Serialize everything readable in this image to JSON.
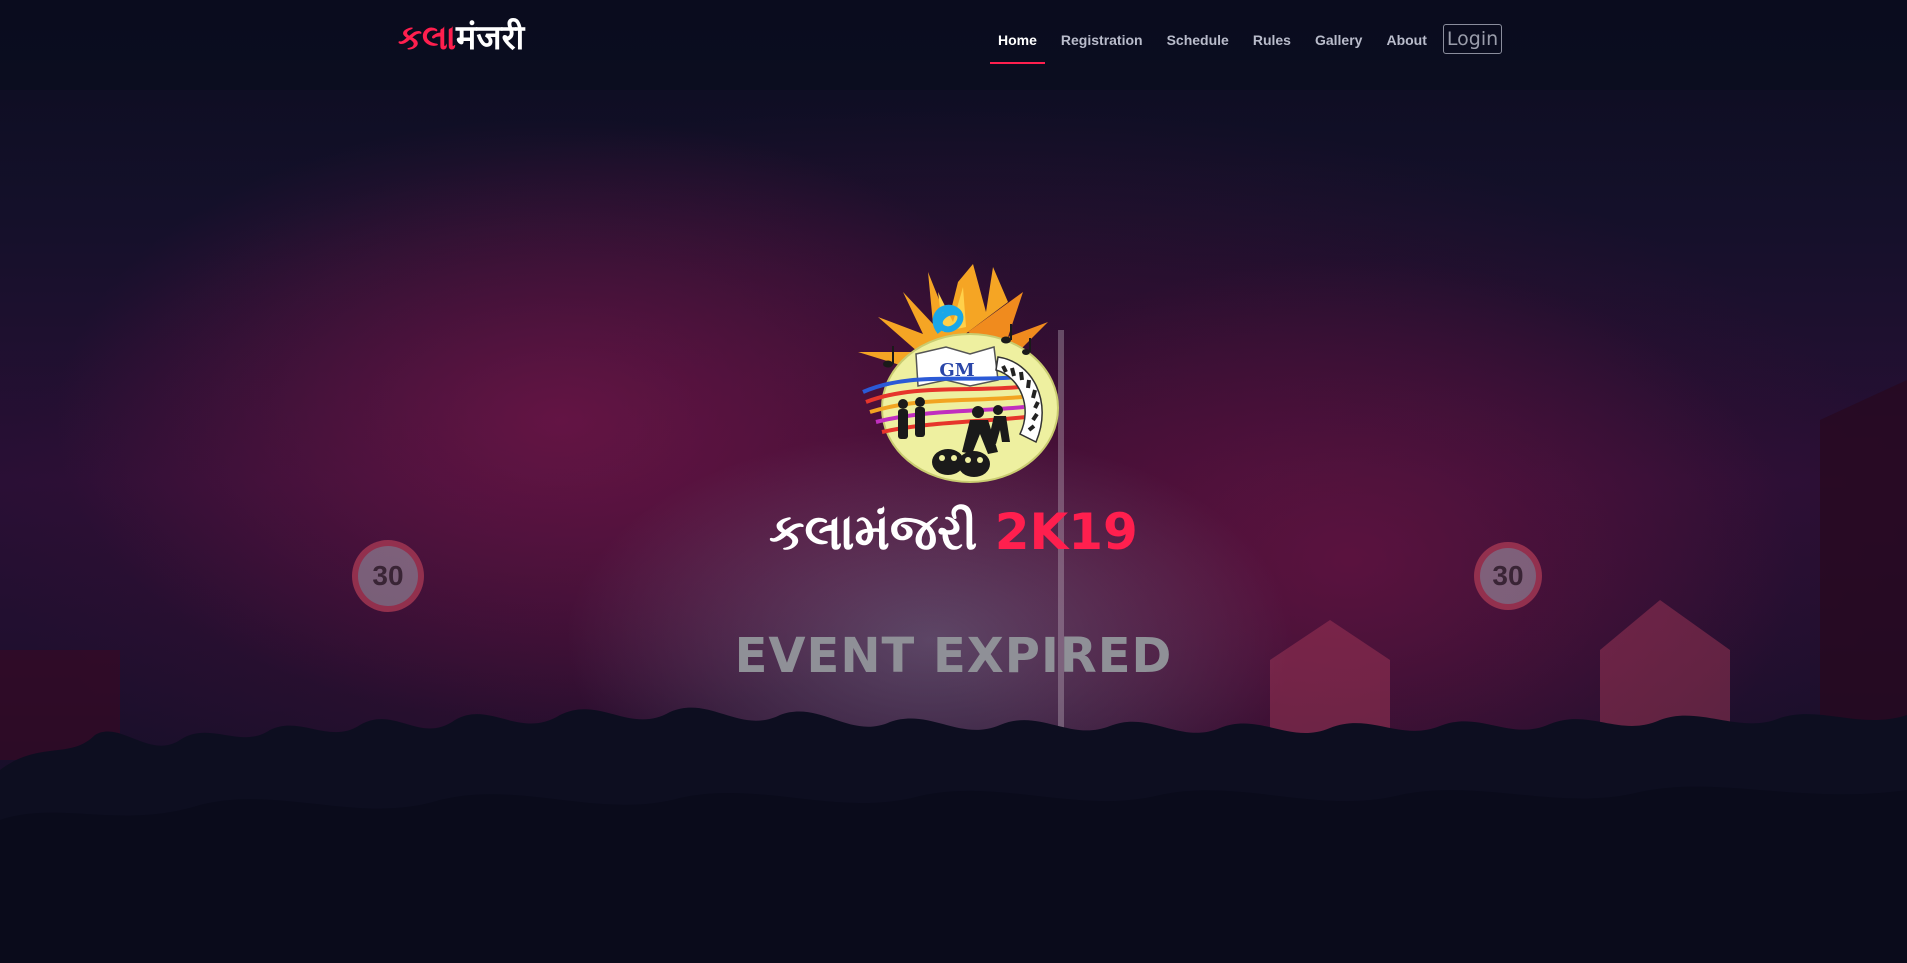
{
  "brand": {
    "part_red": "કલા",
    "part_white": "मंजरी"
  },
  "nav": {
    "items": [
      {
        "label": "Home",
        "active": true
      },
      {
        "label": "Registration",
        "active": false
      },
      {
        "label": "Schedule",
        "active": false
      },
      {
        "label": "Rules",
        "active": false
      },
      {
        "label": "Gallery",
        "active": false
      },
      {
        "label": "About",
        "active": false
      }
    ],
    "login_label": "Login"
  },
  "hero": {
    "logo_text": "GM",
    "title_main": "કલામંજરી ",
    "title_accent": "2K19",
    "status": "EVENT EXPIRED"
  },
  "background": {
    "sign_left": "30",
    "sign_right": "30"
  },
  "colors": {
    "accent": "#ff1f4e",
    "background": "#0b0d1f",
    "nav_text": "#b9bccb",
    "status_text": "#8f9097"
  }
}
